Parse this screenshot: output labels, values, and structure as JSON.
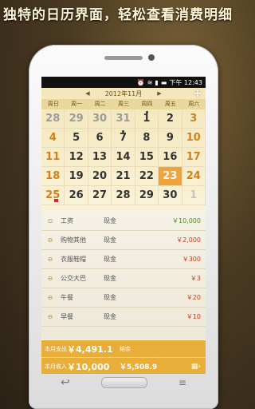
{
  "headline": "独特的日历界面，轻松查看消费明细",
  "status": {
    "time": "下午 12:43"
  },
  "calendar": {
    "month_label": "2012年11月",
    "prev": "◀",
    "next": "▶",
    "add": "+",
    "weekdays": [
      "周日",
      "周一",
      "周二",
      "周三",
      "周四",
      "周五",
      "周六"
    ],
    "days": [
      [
        "28",
        "29",
        "30",
        "31",
        "1",
        "2",
        "3"
      ],
      [
        "4",
        "5",
        "6",
        "7",
        "8",
        "9",
        "10"
      ],
      [
        "11",
        "12",
        "13",
        "14",
        "15",
        "16",
        "17"
      ],
      [
        "18",
        "19",
        "20",
        "21",
        "22",
        "23",
        "24"
      ],
      [
        "25",
        "26",
        "27",
        "28",
        "29",
        "30",
        "1"
      ]
    ]
  },
  "transactions": [
    {
      "category": "工资",
      "account": "现金",
      "amount": "￥10,000",
      "type": "income"
    },
    {
      "category": "购物其他",
      "account": "现金",
      "amount": "￥2,000",
      "type": "expense"
    },
    {
      "category": "衣服鞋帽",
      "account": "现金",
      "amount": "￥300",
      "type": "expense"
    },
    {
      "category": "公交大巴",
      "account": "现金",
      "amount": "￥3",
      "type": "expense"
    },
    {
      "category": "午餐",
      "account": "现金",
      "amount": "￥20",
      "type": "expense"
    },
    {
      "category": "早餐",
      "account": "现金",
      "amount": "￥10",
      "type": "expense"
    }
  ],
  "footer": {
    "expense_label": "本月支出",
    "expense_value": "￥4,491.1",
    "balance_label": "结余",
    "income_label": "本月收入",
    "income_value": "￥10,000",
    "balance_value": "￥5,508.9"
  },
  "colors": {
    "accent": "#e8ae3a",
    "today": "#f0a33a",
    "expense": "#c93a1e",
    "income": "#4e8c1f"
  }
}
